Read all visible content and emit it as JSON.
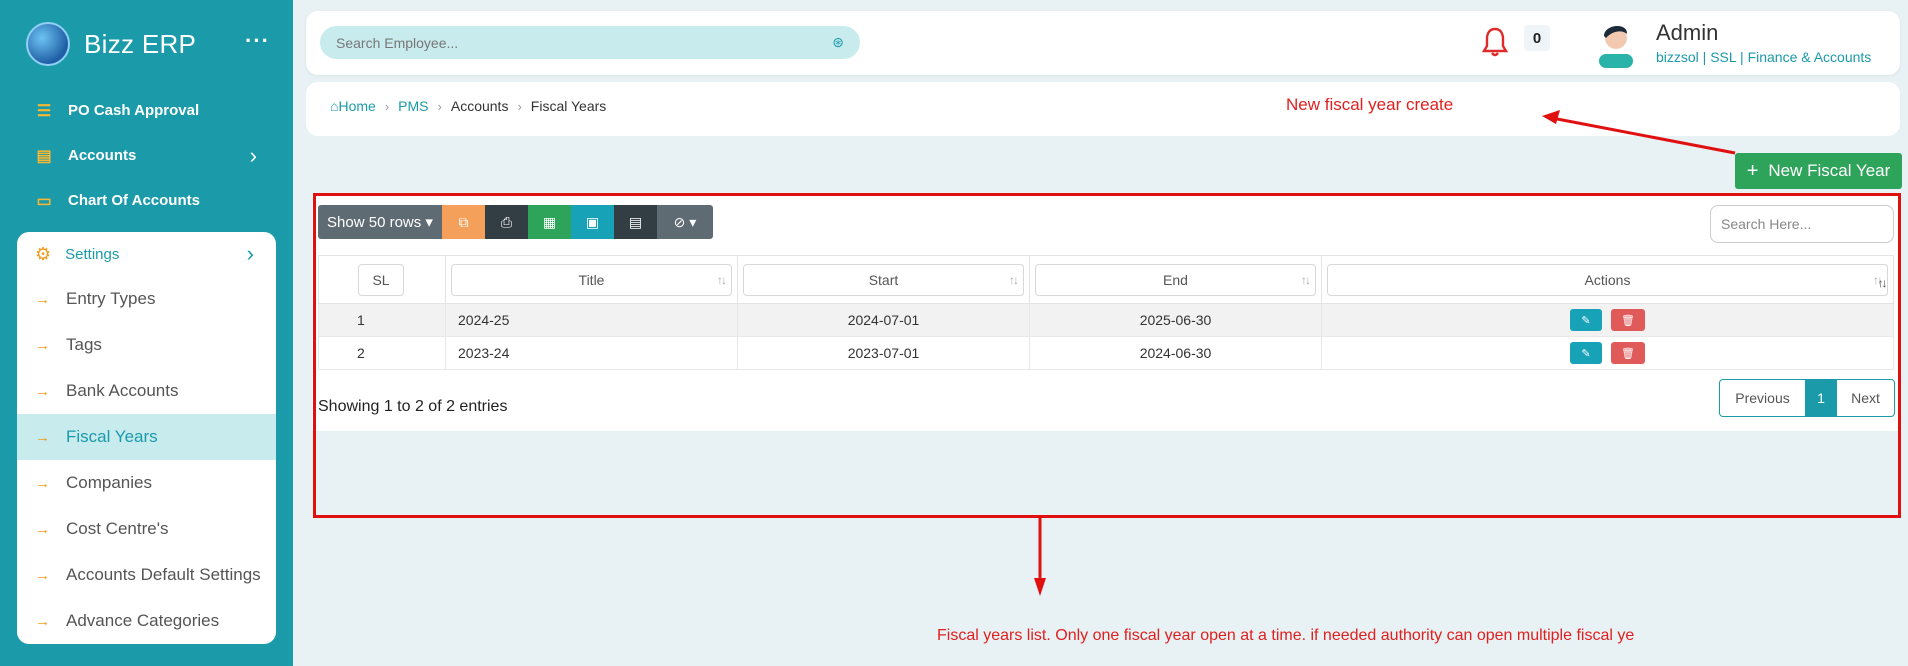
{
  "app": {
    "name": "Bizz ERP"
  },
  "sidebar": {
    "top_items": [
      {
        "label": "PO Cash Approval"
      },
      {
        "label": "Accounts"
      },
      {
        "label": "Chart Of Accounts"
      }
    ],
    "settings": {
      "label": "Settings",
      "items": [
        {
          "label": "Entry Types"
        },
        {
          "label": "Tags"
        },
        {
          "label": "Bank Accounts"
        },
        {
          "label": "Fiscal Years"
        },
        {
          "label": "Companies"
        },
        {
          "label": "Cost Centre's"
        },
        {
          "label": "Accounts Default Settings"
        },
        {
          "label": "Advance Categories"
        }
      ]
    }
  },
  "header": {
    "search_placeholder": "Search Employee...",
    "notification_count": "0",
    "user_name": "Admin",
    "user_sub": "bizzsol | SSL  | Finance & Accounts"
  },
  "breadcrumb": {
    "home": "Home",
    "pms": "PMS",
    "accounts": "Accounts",
    "current": "Fiscal Years"
  },
  "new_button": "New Fiscal Year",
  "toolbar": {
    "rows_label": "Show 50 rows"
  },
  "table": {
    "search_placeholder": "Search Here...",
    "headers": {
      "sl": "SL",
      "title": "Title",
      "start": "Start",
      "end": "End",
      "actions": "Actions"
    },
    "rows": [
      {
        "sl": "1",
        "title": "2024-25",
        "start": "2024-07-01",
        "end": "2025-06-30"
      },
      {
        "sl": "2",
        "title": "2023-24",
        "start": "2023-07-01",
        "end": "2024-06-30"
      }
    ],
    "info": "Showing 1 to 2 of 2 entries",
    "pager": {
      "previous": "Previous",
      "current": "1",
      "next": "Next"
    }
  },
  "annotations": {
    "top": "New fiscal year create",
    "bottom": "Fiscal years list. Only one fiscal year open at a time. if needed authority can open multiple fiscal ye"
  }
}
